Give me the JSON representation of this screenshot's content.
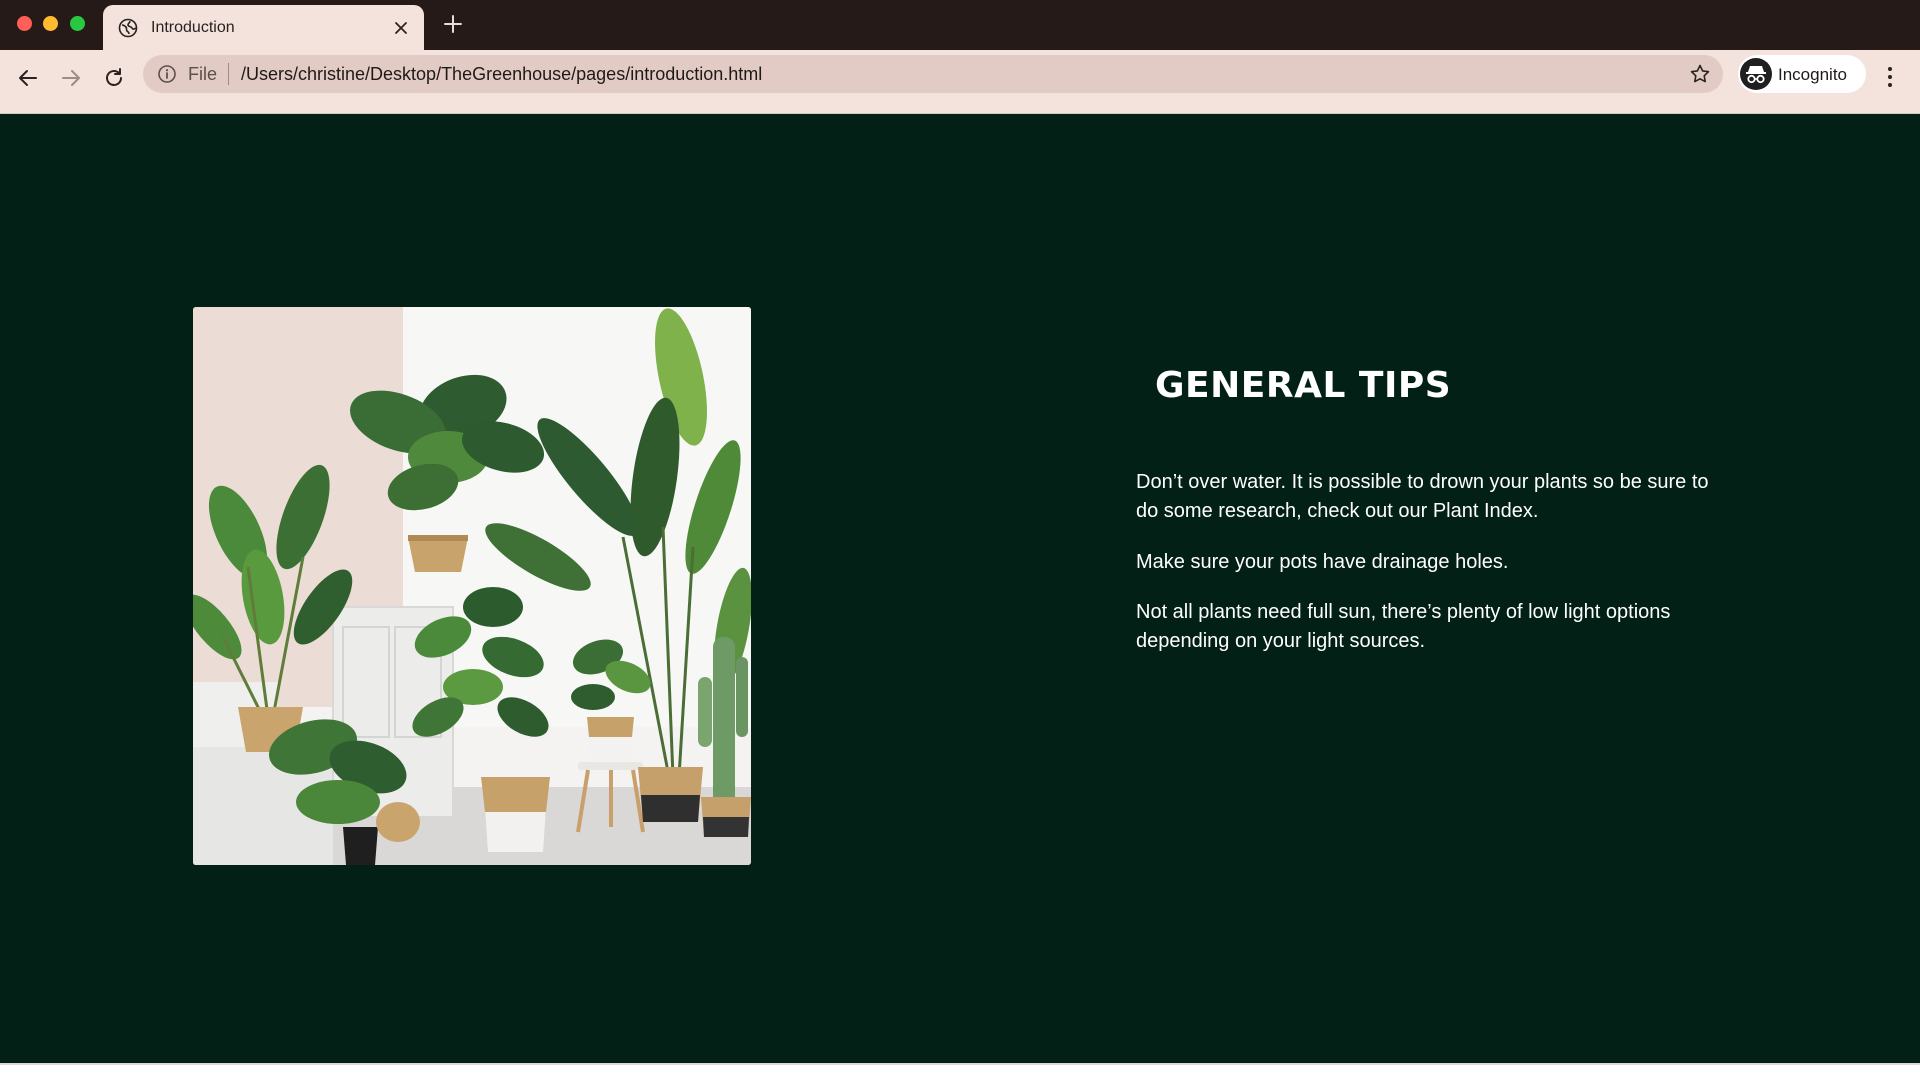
{
  "browser": {
    "tab": {
      "title": "Introduction",
      "icon": "globe-icon"
    },
    "toolbar": {
      "scheme": "File",
      "url": "/Users/christine/Desktop/TheGreenhouse/pages/introduction.html",
      "profile_label": "Incognito"
    },
    "colors": {
      "tabstrip": "#251a18",
      "toolbar": "#f4e2dc",
      "omnibox": "#e2cbc4"
    }
  },
  "page": {
    "background": "#022015",
    "image_alt": "potted plants",
    "heading": "GENERAL TIPS",
    "tips": [
      "Don’t over water. It is possible to drown your plants so be sure to do some research, check out our Plant Index.",
      "Make sure your pots have drainage holes.",
      "Not all plants need full sun, there’s plenty of low light options depending on your light sources."
    ]
  }
}
